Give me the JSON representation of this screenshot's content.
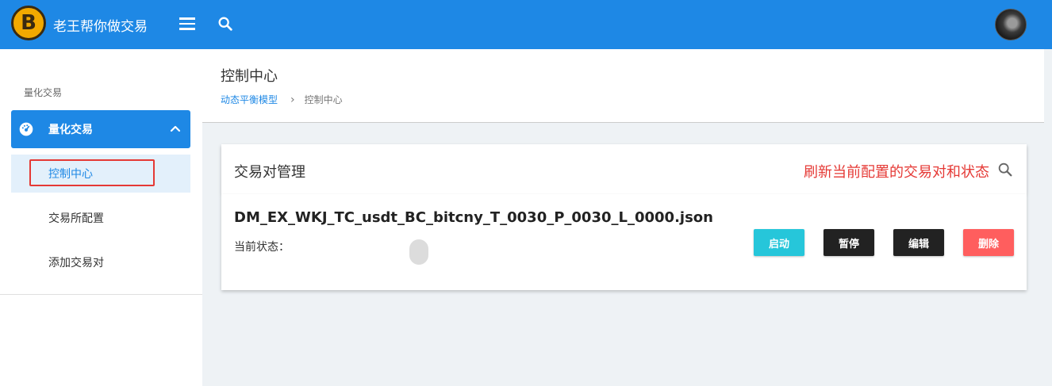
{
  "header": {
    "logo_letter": "B",
    "app_title": "老王帮你做交易"
  },
  "sidebar": {
    "section_label": "量化交易",
    "group_label": "量化交易",
    "items": [
      {
        "label": "控制中心"
      },
      {
        "label": "交易所配置"
      },
      {
        "label": "添加交易对"
      }
    ]
  },
  "page": {
    "title": "控制中心",
    "breadcrumb": {
      "parent": "动态平衡模型",
      "separator": "›",
      "current": "控制中心"
    }
  },
  "card": {
    "title": "交易对管理",
    "refresh_text": "刷新当前配置的交易对和状态",
    "pair": {
      "name": "DM_EX_WKJ_TC_usdt_BC_bitcny_T_0030_P_0030_L_0000.json",
      "status_label": "当前状态："
    },
    "buttons": {
      "start": "启动",
      "pause": "暂停",
      "edit": "编辑",
      "delete": "删除"
    }
  },
  "colors": {
    "primary": "#1e88e5",
    "accent_red": "#e53935",
    "start": "#26c6da",
    "dark": "#222222",
    "delete": "#ff5e5e"
  }
}
